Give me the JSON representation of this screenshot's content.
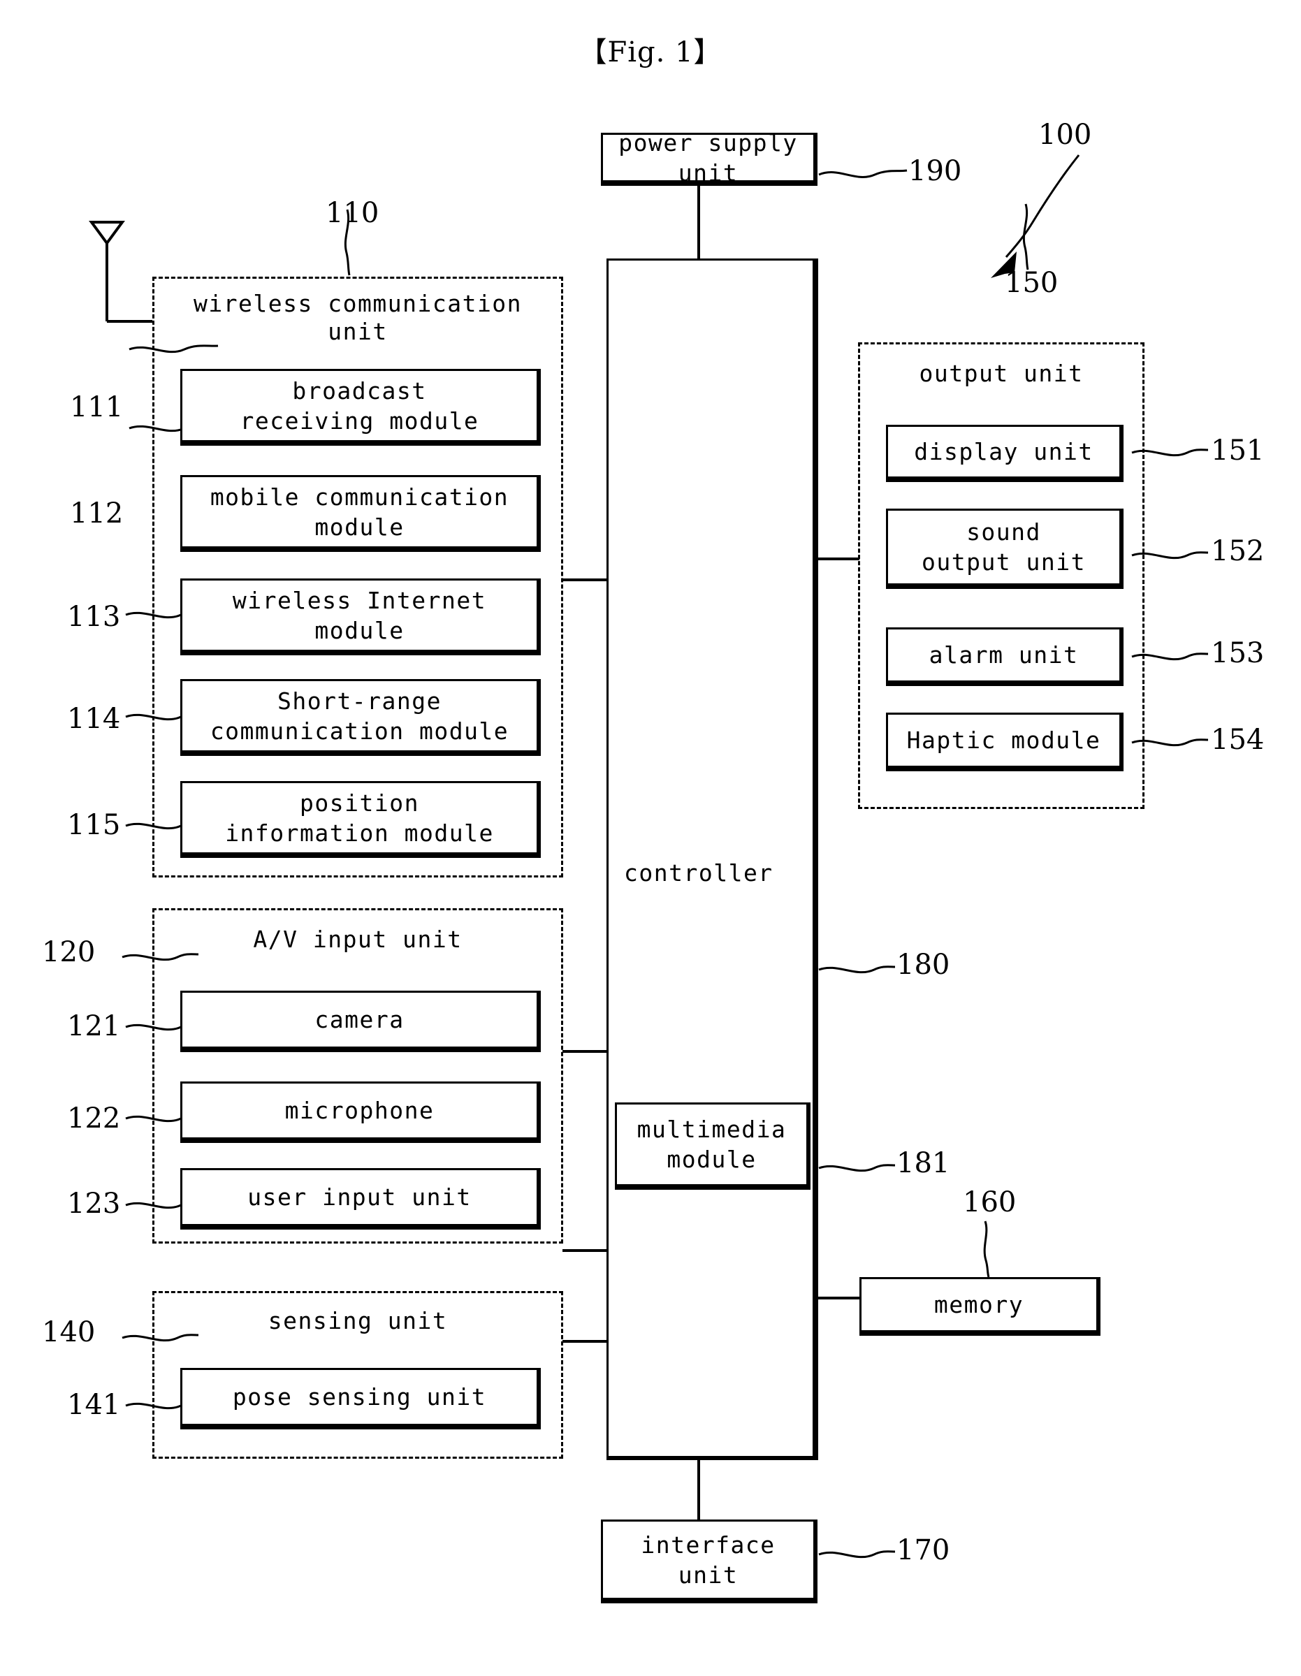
{
  "figure": {
    "title": "【Fig. 1】",
    "overall_ref": "100"
  },
  "power_supply": {
    "label": "power supply\nunit",
    "ref": "190"
  },
  "controller": {
    "label": "controller",
    "ref": "180",
    "multimedia": {
      "label": "multimedia\nmodule",
      "ref": "181"
    }
  },
  "wireless_unit": {
    "title": "wireless communication\nunit",
    "ref": "110",
    "modules": [
      {
        "label": "broadcast\nreceiving module",
        "ref": "111"
      },
      {
        "label": "mobile communication\nmodule",
        "ref": "112"
      },
      {
        "label": "wireless Internet\nmodule",
        "ref": "113"
      },
      {
        "label": "Short-range\ncommunication module",
        "ref": "114"
      },
      {
        "label": "position\ninformation module",
        "ref": "115"
      }
    ]
  },
  "av_input_unit": {
    "title": "A/V input unit",
    "ref": "120",
    "modules": [
      {
        "label": "camera",
        "ref": "121"
      },
      {
        "label": "microphone",
        "ref": "122"
      },
      {
        "label": "user input unit",
        "ref": "123"
      }
    ]
  },
  "sensing_unit": {
    "title": "sensing unit",
    "ref": "140",
    "modules": [
      {
        "label": "pose sensing unit",
        "ref": "141"
      }
    ]
  },
  "output_unit": {
    "title": "output unit",
    "ref": "150",
    "modules": [
      {
        "label": "display unit",
        "ref": "151"
      },
      {
        "label": "sound\noutput unit",
        "ref": "152"
      },
      {
        "label": "alarm unit",
        "ref": "153"
      },
      {
        "label": "Haptic module",
        "ref": "154"
      }
    ]
  },
  "memory": {
    "label": "memory",
    "ref": "160"
  },
  "interface_unit": {
    "label": "interface\nunit",
    "ref": "170"
  },
  "antenna": {
    "icon": "antenna-icon"
  }
}
